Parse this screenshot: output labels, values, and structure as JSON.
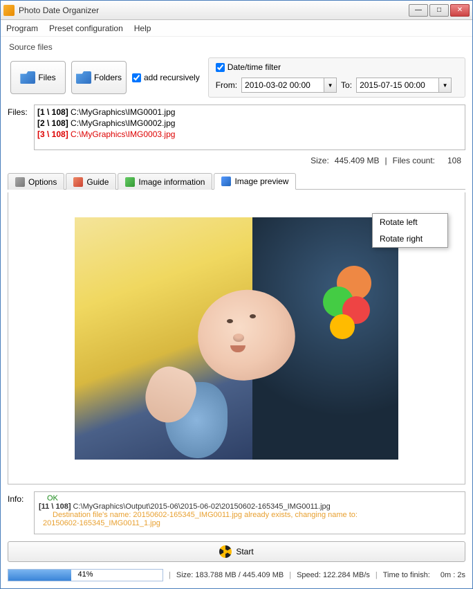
{
  "title": "Photo Date Organizer",
  "menu": {
    "program": "Program",
    "preset": "Preset configuration",
    "help": "Help"
  },
  "source_label": "Source files",
  "buttons": {
    "files": "Files",
    "folders": "Folders"
  },
  "add_recursively": "add recursively",
  "filter": {
    "label": "Date/time filter",
    "from_label": "From:",
    "from_value": "2010-03-02 00:00",
    "to_label": "To:",
    "to_value": "2015-07-15 00:00"
  },
  "files_label": "Files:",
  "file_rows": [
    {
      "idx": "[1 \\ 108]",
      "path": "C:\\MyGraphics\\IMG0001.jpg",
      "sel": false
    },
    {
      "idx": "[2 \\ 108]",
      "path": "C:\\MyGraphics\\IMG0002.jpg",
      "sel": false
    },
    {
      "idx": "[3 \\ 108]",
      "path": "C:\\MyGraphics\\IMG0003.jpg",
      "sel": true
    }
  ],
  "stats": {
    "size_label": "Size:",
    "size_value": "445.409 MB",
    "count_label": "Files count:",
    "count_value": "108"
  },
  "tabs": {
    "options": "Options",
    "guide": "Guide",
    "info": "Image information",
    "preview": "Image preview"
  },
  "context": {
    "left": "Rotate left",
    "right": "Rotate right"
  },
  "info_label": "Info:",
  "info": {
    "ok": "OK",
    "dest_idx": "[11 \\ 108]",
    "dest_path": "C:\\MyGraphics\\Output\\2015-06\\2015-06-02\\20150602-165345_IMG0011.jpg",
    "warn1": "Destination file's name: 20150602-165345_IMG0011.jpg already exists, changing name to:",
    "warn2": "20150602-165345_IMG0011_1.jpg"
  },
  "start_label": "Start",
  "status": {
    "percent": "41%",
    "size_label": "Size:",
    "size_text": "183.788 MB  /  445.409 MB",
    "speed_label": "Speed:",
    "speed_value": "122.284 MB/s",
    "ttf_label": "Time to finish:",
    "ttf_value": "0m : 2s"
  }
}
